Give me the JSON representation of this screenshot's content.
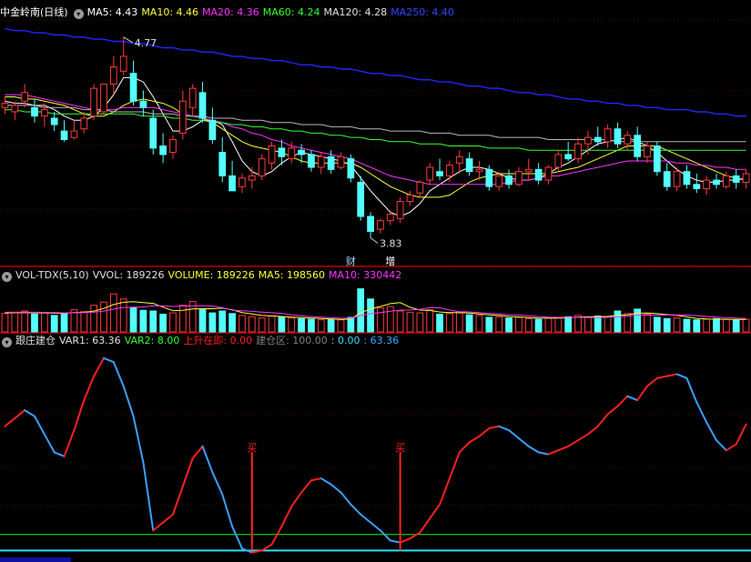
{
  "colors": {
    "background": "#000000",
    "divider": "#b00000",
    "grid": "#5a0000",
    "candle_up": "#ff3a3a",
    "candle_down": "#54ffff",
    "ma5": "#ffffff",
    "ma10": "#ffff33",
    "ma20": "#ff33ff",
    "ma60": "#33ff33",
    "ma120": "#b8b8b8",
    "ma250": "#2424ff",
    "var1_up": "#ff2020",
    "var1_down": "#3aa0ff",
    "var1_neutral": "#ffffff",
    "var2": "#00ff00",
    "base_line": "#33ddff",
    "buy_signal": "#ff2020"
  },
  "price_panel": {
    "title": "中金岭南(日线)",
    "indicators": [
      {
        "label": "MA5: 4.43",
        "color": "#ffffff"
      },
      {
        "label": "MA10: 4.46",
        "color": "#ffff33"
      },
      {
        "label": "MA20: 4.36",
        "color": "#ff33ff"
      },
      {
        "label": "MA60: 4.24",
        "color": "#33ff33"
      },
      {
        "label": "MA120: 4.28",
        "color": "#e0e0e0"
      },
      {
        "label": "MA250: 4.40",
        "color": "#3344ff"
      }
    ],
    "high_label": "4.77",
    "low_label": "3.83",
    "events": [
      {
        "label": "财",
        "color": "#9fd8ff"
      },
      {
        "label": "增",
        "color": "#ffffff"
      }
    ]
  },
  "volume_panel": {
    "indicators": [
      {
        "label": "VOL-TDX(5,10)",
        "color": "#e0e0e0"
      },
      {
        "label": "VVOL: 189226",
        "color": "#e0e0e0"
      },
      {
        "label": "VOLUME: 189226",
        "color": "#ffff33"
      },
      {
        "label": "MA5: 198560",
        "color": "#ffff33"
      },
      {
        "label": "MA10: 330442",
        "color": "#ff33ff"
      }
    ]
  },
  "indicator_panel": {
    "indicators": [
      {
        "label": "跟庄建仓",
        "color": "#e0e0e0"
      },
      {
        "label": "VAR1: 63.36",
        "color": "#e0e0e0"
      },
      {
        "label": "VAR2: 8.00",
        "color": "#33ff33"
      },
      {
        "label": "上升在即: 0.00",
        "color": "#ff2020"
      },
      {
        "label": "建仓区: 100.00",
        "color": "#808080"
      },
      {
        "label": ": 0.00",
        "color": "#33ddff"
      },
      {
        "label": ": 63.36",
        "color": "#33aaff"
      }
    ],
    "buy_label": "买"
  },
  "chart_data": {
    "type": "candlestick",
    "ylim_price": [
      3.7,
      4.85
    ],
    "candles": [
      [
        4.44,
        4.49,
        4.41,
        4.46
      ],
      [
        4.42,
        4.47,
        4.38,
        4.45
      ],
      [
        4.47,
        4.55,
        4.44,
        4.51
      ],
      [
        4.44,
        4.48,
        4.37,
        4.4
      ],
      [
        4.4,
        4.46,
        4.35,
        4.43
      ],
      [
        4.39,
        4.42,
        4.33,
        4.36
      ],
      [
        4.33,
        4.38,
        4.28,
        4.29
      ],
      [
        4.3,
        4.38,
        4.29,
        4.33
      ],
      [
        4.34,
        4.42,
        4.32,
        4.39
      ],
      [
        4.4,
        4.55,
        4.38,
        4.53
      ],
      [
        4.42,
        4.55,
        4.41,
        4.55
      ],
      [
        4.55,
        4.68,
        4.5,
        4.63
      ],
      [
        4.61,
        4.77,
        4.59,
        4.68
      ],
      [
        4.6,
        4.66,
        4.45,
        4.47
      ],
      [
        4.47,
        4.52,
        4.4,
        4.44
      ],
      [
        4.39,
        4.43,
        4.22,
        4.25
      ],
      [
        4.26,
        4.32,
        4.18,
        4.22
      ],
      [
        4.23,
        4.31,
        4.2,
        4.29
      ],
      [
        4.32,
        4.52,
        4.29,
        4.47
      ],
      [
        4.44,
        4.55,
        4.4,
        4.53
      ],
      [
        4.51,
        4.56,
        4.37,
        4.39
      ],
      [
        4.38,
        4.44,
        4.27,
        4.29
      ],
      [
        4.23,
        4.3,
        4.09,
        4.12
      ],
      [
        4.12,
        4.19,
        4.05,
        4.05
      ],
      [
        4.07,
        4.13,
        4.04,
        4.11
      ],
      [
        4.1,
        4.16,
        4.06,
        4.12
      ],
      [
        4.12,
        4.22,
        4.1,
        4.2
      ],
      [
        4.18,
        4.28,
        4.15,
        4.26
      ],
      [
        4.25,
        4.29,
        4.17,
        4.21
      ],
      [
        4.2,
        4.28,
        4.18,
        4.25
      ],
      [
        4.24,
        4.27,
        4.18,
        4.22
      ],
      [
        4.22,
        4.24,
        4.14,
        4.16
      ],
      [
        4.16,
        4.23,
        4.13,
        4.21
      ],
      [
        4.21,
        4.24,
        4.13,
        4.15
      ],
      [
        4.16,
        4.23,
        4.15,
        4.21
      ],
      [
        4.2,
        4.22,
        4.09,
        4.11
      ],
      [
        4.09,
        4.12,
        3.91,
        3.93
      ],
      [
        3.93,
        3.95,
        3.83,
        3.86
      ],
      [
        3.87,
        3.92,
        3.85,
        3.91
      ],
      [
        3.91,
        3.95,
        3.89,
        3.94
      ],
      [
        3.92,
        4.02,
        3.9,
        4.0
      ],
      [
        4.0,
        4.05,
        3.98,
        4.03
      ],
      [
        4.04,
        4.1,
        4.02,
        4.09
      ],
      [
        4.1,
        4.18,
        4.08,
        4.16
      ],
      [
        4.14,
        4.2,
        4.1,
        4.12
      ],
      [
        4.12,
        4.19,
        4.09,
        4.17
      ],
      [
        4.18,
        4.24,
        4.13,
        4.21
      ],
      [
        4.2,
        4.23,
        4.12,
        4.14
      ],
      [
        4.14,
        4.19,
        4.1,
        4.15
      ],
      [
        4.15,
        4.17,
        4.05,
        4.07
      ],
      [
        4.07,
        4.14,
        4.05,
        4.12
      ],
      [
        4.12,
        4.15,
        4.06,
        4.08
      ],
      [
        4.08,
        4.16,
        4.07,
        4.14
      ],
      [
        4.14,
        4.2,
        4.1,
        4.15
      ],
      [
        4.15,
        4.18,
        4.08,
        4.1
      ],
      [
        4.1,
        4.17,
        4.08,
        4.16
      ],
      [
        4.16,
        4.24,
        4.14,
        4.22
      ],
      [
        4.22,
        4.28,
        4.19,
        4.2
      ],
      [
        4.2,
        4.3,
        4.18,
        4.27
      ],
      [
        4.27,
        4.33,
        4.22,
        4.3
      ],
      [
        4.3,
        4.35,
        4.26,
        4.28
      ],
      [
        4.28,
        4.36,
        4.25,
        4.34
      ],
      [
        4.34,
        4.37,
        4.25,
        4.27
      ],
      [
        4.27,
        4.33,
        4.24,
        4.31
      ],
      [
        4.31,
        4.35,
        4.19,
        4.21
      ],
      [
        4.21,
        4.28,
        4.18,
        4.26
      ],
      [
        4.26,
        4.28,
        4.12,
        4.14
      ],
      [
        4.14,
        4.18,
        4.05,
        4.07
      ],
      [
        4.07,
        4.16,
        4.05,
        4.14
      ],
      [
        4.14,
        4.17,
        4.06,
        4.08
      ],
      [
        4.08,
        4.13,
        4.04,
        4.06
      ],
      [
        4.06,
        4.12,
        4.03,
        4.1
      ],
      [
        4.1,
        4.13,
        4.06,
        4.08
      ],
      [
        4.07,
        4.14,
        4.06,
        4.12
      ],
      [
        4.12,
        4.15,
        4.06,
        4.09
      ],
      [
        4.09,
        4.15,
        4.06,
        4.13
      ]
    ],
    "ma_series": {
      "MA5": [
        4.47,
        4.46,
        4.46,
        4.45,
        4.45,
        4.43,
        4.4,
        4.38,
        4.38,
        4.4,
        4.44,
        4.5,
        4.58,
        4.58,
        4.56,
        4.49,
        4.41,
        4.33,
        4.33,
        4.35,
        4.38,
        4.38,
        4.36,
        4.28,
        4.19,
        4.14,
        4.12,
        4.14,
        4.18,
        4.21,
        4.23,
        4.22,
        4.21,
        4.2,
        4.19,
        4.17,
        4.11,
        4.05,
        4.0,
        3.95,
        3.93,
        3.95,
        3.99,
        4.05,
        4.08,
        4.11,
        4.14,
        4.16,
        4.16,
        4.15,
        4.13,
        4.11,
        4.1,
        4.1,
        4.11,
        4.13,
        4.16,
        4.18,
        4.21,
        4.24,
        4.27,
        4.28,
        4.29,
        4.3,
        4.28,
        4.26,
        4.23,
        4.19,
        4.15,
        4.12,
        4.1,
        4.09,
        4.09,
        4.1,
        4.1,
        4.11
      ],
      "MA10": [
        4.49,
        4.49,
        4.48,
        4.48,
        4.47,
        4.46,
        4.45,
        4.43,
        4.41,
        4.4,
        4.4,
        4.42,
        4.45,
        4.47,
        4.48,
        4.47,
        4.46,
        4.44,
        4.41,
        4.4,
        4.39,
        4.37,
        4.34,
        4.31,
        4.28,
        4.26,
        4.25,
        4.24,
        4.23,
        4.21,
        4.19,
        4.18,
        4.18,
        4.18,
        4.18,
        4.18,
        4.16,
        4.13,
        4.1,
        4.07,
        4.05,
        4.03,
        4.02,
        4.02,
        4.02,
        4.03,
        4.06,
        4.09,
        4.11,
        4.12,
        4.13,
        4.13,
        4.13,
        4.13,
        4.13,
        4.13,
        4.14,
        4.15,
        4.16,
        4.18,
        4.2,
        4.22,
        4.24,
        4.26,
        4.26,
        4.26,
        4.26,
        4.24,
        4.22,
        4.2,
        4.18,
        4.16,
        4.14,
        4.12,
        4.11,
        4.1
      ],
      "MA20": [
        4.5,
        4.5,
        4.5,
        4.49,
        4.48,
        4.47,
        4.46,
        4.45,
        4.44,
        4.43,
        4.43,
        4.43,
        4.44,
        4.44,
        4.44,
        4.44,
        4.43,
        4.42,
        4.41,
        4.4,
        4.39,
        4.38,
        4.37,
        4.35,
        4.34,
        4.32,
        4.31,
        4.29,
        4.28,
        4.26,
        4.25,
        4.24,
        4.23,
        4.22,
        4.21,
        4.2,
        4.18,
        4.16,
        4.14,
        4.12,
        4.11,
        4.1,
        4.09,
        4.08,
        4.08,
        4.08,
        4.08,
        4.08,
        4.08,
        4.08,
        4.08,
        4.09,
        4.1,
        4.1,
        4.11,
        4.12,
        4.12,
        4.13,
        4.14,
        4.15,
        4.16,
        4.17,
        4.18,
        4.19,
        4.19,
        4.19,
        4.19,
        4.19,
        4.18,
        4.18,
        4.17,
        4.17,
        4.16,
        4.16,
        4.15,
        4.15
      ],
      "MA60": [
        4.43,
        4.43,
        4.42,
        4.42,
        4.42,
        4.41,
        4.41,
        4.41,
        4.41,
        4.41,
        4.41,
        4.41,
        4.41,
        4.41,
        4.4,
        4.4,
        4.4,
        4.39,
        4.39,
        4.38,
        4.38,
        4.37,
        4.37,
        4.36,
        4.36,
        4.35,
        4.35,
        4.34,
        4.34,
        4.33,
        4.33,
        4.32,
        4.32,
        4.31,
        4.31,
        4.3,
        4.3,
        4.29,
        4.29,
        4.28,
        4.28,
        4.28,
        4.27,
        4.27,
        4.27,
        4.26,
        4.26,
        4.26,
        4.26,
        4.25,
        4.25,
        4.25,
        4.25,
        4.24,
        4.24,
        4.24,
        4.24,
        4.24,
        4.24,
        4.24,
        4.24,
        4.24,
        4.24,
        4.24,
        4.24,
        4.24,
        4.24,
        4.24,
        4.24,
        4.24,
        4.24,
        4.24,
        4.24,
        4.24,
        4.24,
        4.24
      ],
      "MA120": [
        4.45,
        4.45,
        4.45,
        4.45,
        4.44,
        4.44,
        4.44,
        4.44,
        4.43,
        4.43,
        4.43,
        4.42,
        4.42,
        4.42,
        4.42,
        4.41,
        4.41,
        4.41,
        4.4,
        4.4,
        4.4,
        4.39,
        4.39,
        4.39,
        4.38,
        4.38,
        4.38,
        4.37,
        4.37,
        4.37,
        4.36,
        4.36,
        4.36,
        4.35,
        4.35,
        4.35,
        4.34,
        4.34,
        4.34,
        4.33,
        4.33,
        4.33,
        4.33,
        4.32,
        4.32,
        4.32,
        4.31,
        4.31,
        4.31,
        4.31,
        4.3,
        4.3,
        4.3,
        4.3,
        4.3,
        4.29,
        4.29,
        4.29,
        4.29,
        4.29,
        4.29,
        4.29,
        4.28,
        4.28,
        4.28,
        4.28,
        4.28,
        4.28,
        4.28,
        4.28,
        4.28,
        4.28,
        4.28,
        4.28,
        4.28,
        4.28
      ],
      "MA250": [
        4.81,
        4.8,
        4.8,
        4.79,
        4.79,
        4.78,
        4.78,
        4.77,
        4.77,
        4.76,
        4.76,
        4.75,
        4.75,
        4.74,
        4.74,
        4.73,
        4.72,
        4.72,
        4.71,
        4.71,
        4.7,
        4.7,
        4.69,
        4.68,
        4.68,
        4.67,
        4.67,
        4.66,
        4.66,
        4.65,
        4.64,
        4.64,
        4.63,
        4.63,
        4.62,
        4.62,
        4.61,
        4.6,
        4.6,
        4.59,
        4.59,
        4.58,
        4.57,
        4.57,
        4.56,
        4.56,
        4.55,
        4.54,
        4.54,
        4.53,
        4.53,
        4.52,
        4.51,
        4.51,
        4.5,
        4.5,
        4.49,
        4.48,
        4.48,
        4.47,
        4.47,
        4.46,
        4.46,
        4.45,
        4.45,
        4.44,
        4.44,
        4.43,
        4.43,
        4.43,
        4.42,
        4.42,
        4.41,
        4.41,
        4.4,
        4.4
      ]
    },
    "volume": {
      "ylim": [
        0,
        760000
      ],
      "values": [
        290000,
        310000,
        330000,
        280000,
        300000,
        260000,
        290000,
        350000,
        320000,
        420000,
        470000,
        600000,
        520000,
        380000,
        340000,
        330000,
        280000,
        300000,
        420000,
        480000,
        350000,
        300000,
        330000,
        290000,
        260000,
        240000,
        220000,
        250000,
        230000,
        220000,
        210000,
        200000,
        190000,
        200000,
        190000,
        230000,
        680000,
        520000,
        380000,
        400000,
        330000,
        310000,
        300000,
        350000,
        280000,
        290000,
        300000,
        270000,
        260000,
        230000,
        240000,
        220000,
        230000,
        210000,
        200000,
        220000,
        230000,
        240000,
        260000,
        230000,
        250000,
        240000,
        330000,
        290000,
        360000,
        280000,
        230000,
        210000,
        220000,
        200000,
        190000,
        200000,
        210000,
        195000,
        189226,
        200000
      ],
      "ma5": [
        300000,
        302000,
        305000,
        300000,
        302000,
        296000,
        294000,
        306000,
        308000,
        328000,
        370000,
        432000,
        468000,
        478000,
        462000,
        450000,
        390000,
        336000,
        340000,
        362000,
        366000,
        366000,
        374000,
        350000,
        306000,
        284000,
        260000,
        252000,
        244000,
        234000,
        226000,
        220000,
        212000,
        204000,
        198000,
        204000,
        300000,
        364000,
        402000,
        446000,
        462000,
        388000,
        344000,
        338000,
        314000,
        306000,
        304000,
        298000,
        282000,
        270000,
        260000,
        244000,
        236000,
        226000,
        220000,
        216000,
        218000,
        222000,
        232000,
        238000,
        242000,
        244000,
        262000,
        270000,
        294000,
        300000,
        288000,
        274000,
        262000,
        238000,
        214000,
        204000,
        202000,
        199000,
        196000,
        198560
      ],
      "ma10": [
        310000,
        310000,
        312000,
        310000,
        308000,
        304000,
        300000,
        302000,
        304000,
        312000,
        328000,
        360000,
        386000,
        392000,
        394000,
        410000,
        412000,
        402000,
        408000,
        412000,
        414000,
        408000,
        382000,
        344000,
        334000,
        324000,
        312000,
        302000,
        292000,
        270000,
        255000,
        240000,
        232000,
        224000,
        216000,
        215000,
        260000,
        288000,
        305000,
        326000,
        344000,
        346000,
        354000,
        384000,
        380000,
        346000,
        320000,
        316000,
        306000,
        292000,
        282000,
        271000,
        267000,
        254000,
        243000,
        232000,
        230000,
        229000,
        229000,
        228000,
        228000,
        231000,
        240000,
        246000,
        266000,
        268000,
        265000,
        268000,
        266000,
        266000,
        257000,
        244000,
        232000,
        224000,
        218000,
        211000
      ]
    },
    "indicator": {
      "ylim": [
        -3,
        100
      ],
      "var1": [
        62,
        66,
        70,
        67,
        58,
        49,
        47,
        60,
        75,
        87,
        96,
        94,
        82,
        67,
        44,
        10,
        14,
        18,
        32,
        46,
        52,
        39,
        28,
        12,
        1,
        -1,
        0,
        3,
        12,
        22,
        29,
        35,
        36,
        33,
        29,
        23,
        18,
        14,
        10,
        5,
        4,
        6,
        9,
        16,
        23,
        36,
        49,
        54,
        57,
        61,
        62,
        60,
        56,
        52,
        49,
        48,
        50,
        52,
        55,
        58,
        62,
        68,
        72,
        77,
        75,
        82,
        86,
        87,
        88,
        86,
        74,
        64,
        55,
        50,
        53,
        63
      ],
      "var2_level": 8,
      "base_level": 0,
      "buy_signals": [
        25,
        40
      ]
    }
  }
}
